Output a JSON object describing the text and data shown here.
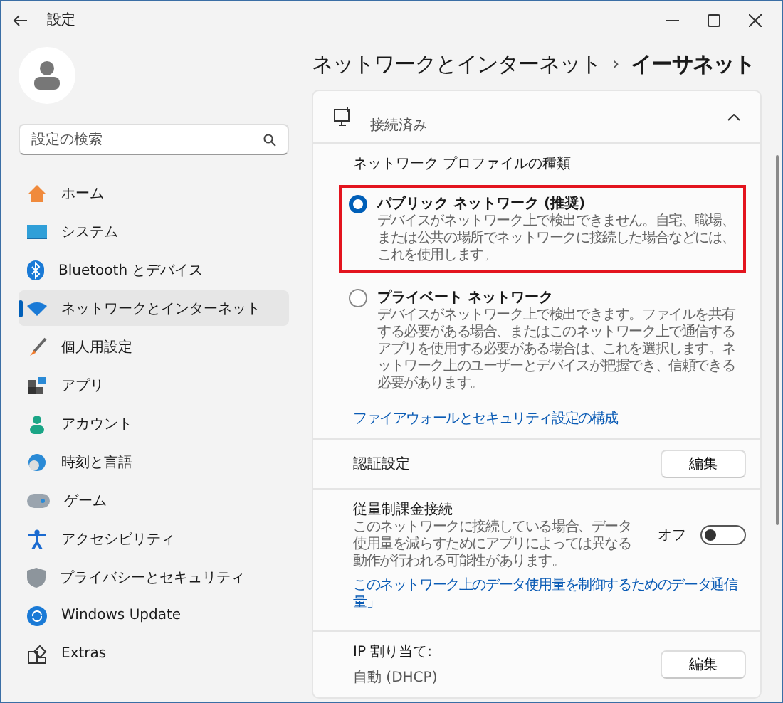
{
  "window": {
    "title": "設定"
  },
  "sidebar": {
    "search": {
      "placeholder": "設定の検索"
    },
    "items": [
      {
        "label": "ホーム",
        "selected": false
      },
      {
        "label": "システム",
        "selected": false
      },
      {
        "label": "Bluetooth とデバイス",
        "selected": false
      },
      {
        "label": "ネットワークとインターネット",
        "selected": true
      },
      {
        "label": "個人用設定",
        "selected": false
      },
      {
        "label": "アプリ",
        "selected": false
      },
      {
        "label": "アカウント",
        "selected": false
      },
      {
        "label": "時刻と言語",
        "selected": false
      },
      {
        "label": "ゲーム",
        "selected": false
      },
      {
        "label": "アクセシビリティ",
        "selected": false
      },
      {
        "label": "プライバシーとセキュリティ",
        "selected": false
      },
      {
        "label": "Windows Update",
        "selected": false
      },
      {
        "label": "Extras",
        "selected": false
      }
    ]
  },
  "breadcrumb": {
    "parent": "ネットワークとインターネット",
    "separator": "›",
    "current": "イーサネット"
  },
  "connection": {
    "status": "接続済み",
    "expanded": true
  },
  "profile": {
    "heading": "ネットワーク プロファイルの種類",
    "options": [
      {
        "label": "パブリック ネットワーク (推奨)",
        "description": "デバイスがネットワーク上で検出できません。自宅、職場、または公共の場所でネットワークに接続した場合などには、これを使用します。",
        "selected": true,
        "highlighted": true
      },
      {
        "label": "プライベート ネットワーク",
        "description": "デバイスがネットワーク上で検出できます。ファイルを共有する必要がある場合、またはこのネットワーク上で通信するアプリを使用する必要がある場合は、これを選択します。ネットワーク上のユーザーとデバイスが把握でき、信頼できる必要があります。",
        "selected": false,
        "highlighted": false
      }
    ],
    "link": "ファイアウォールとセキュリティ設定の構成"
  },
  "auth": {
    "label": "認証設定",
    "button": "編集"
  },
  "metered": {
    "label": "従量制課金接続",
    "description": "このネットワークに接続している場合、データ使用量を減らすためにアプリによっては異なる動作が行われる可能性があります。",
    "state_text": "オフ",
    "on": false,
    "link": "このネットワーク上のデータ使用量を制御するためのデータ通信量」"
  },
  "ip": {
    "label": "IP 割り当て:",
    "value": "自動 (DHCP)",
    "button": "編集"
  }
}
